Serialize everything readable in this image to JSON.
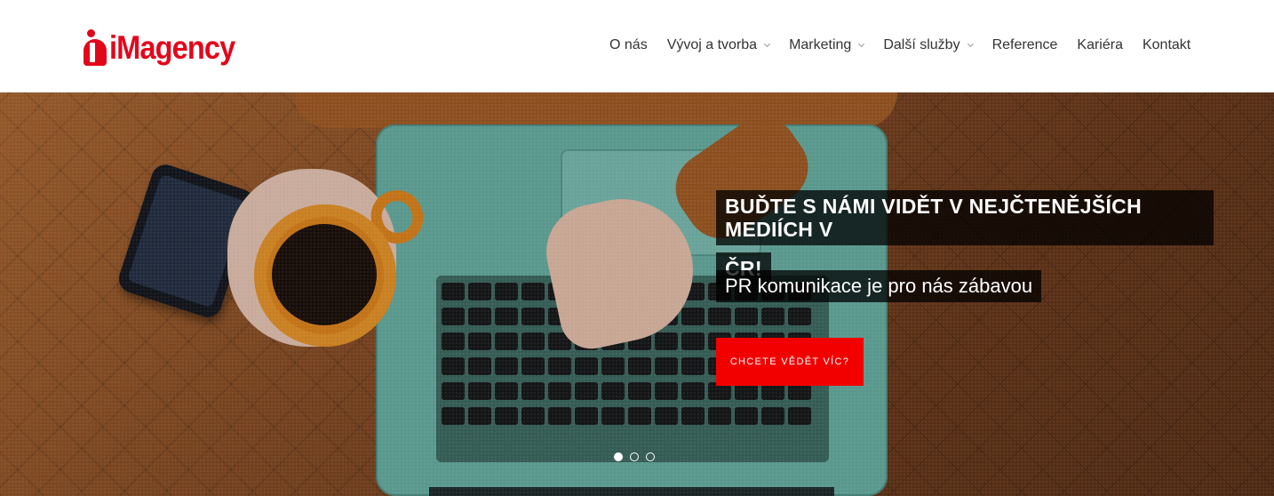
{
  "header": {
    "logo_text": "iMagency",
    "logo_color": "#e3061b",
    "nav": [
      {
        "label": "O nás",
        "has_dropdown": false
      },
      {
        "label": "Vývoj a tvorba",
        "has_dropdown": true
      },
      {
        "label": "Marketing",
        "has_dropdown": true
      },
      {
        "label": "Další služby",
        "has_dropdown": true
      },
      {
        "label": "Reference",
        "has_dropdown": false
      },
      {
        "label": "Kariéra",
        "has_dropdown": false
      },
      {
        "label": "Kontakt",
        "has_dropdown": false
      }
    ]
  },
  "hero": {
    "headline_line1": "BUĎTE S NÁMI VIDĚT V NEJČTENĚJŠÍCH MEDIÍCH V",
    "headline_line2": "ČR!",
    "subtitle": "PR komunikace je pro nás zábavou",
    "cta_label": "CHCETE VĚDĚT VÍC?",
    "cta_color": "#f20000",
    "slides": 3,
    "active_slide": 1
  }
}
